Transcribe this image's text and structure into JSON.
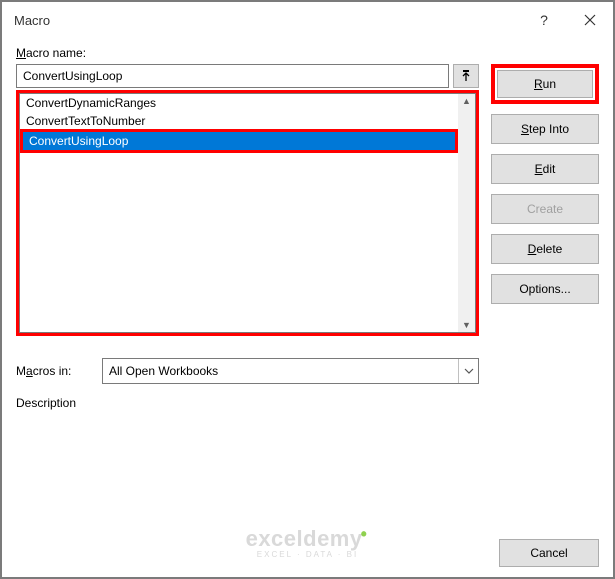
{
  "titlebar": {
    "title": "Macro"
  },
  "labels": {
    "macro_name": "Macro name:",
    "macros_in": "Macros in:",
    "description": "Description"
  },
  "name_input": {
    "value": "ConvertUsingLoop"
  },
  "list": {
    "items": [
      {
        "label": "ConvertDynamicRanges",
        "selected": false
      },
      {
        "label": "ConvertTextToNumber",
        "selected": false
      },
      {
        "label": "ConvertUsingLoop",
        "selected": true
      }
    ]
  },
  "macros_in_select": {
    "value": "All Open Workbooks"
  },
  "buttons": {
    "run": "Run",
    "step_into": "Step Into",
    "edit": "Edit",
    "create": "Create",
    "delete": "Delete",
    "options": "Options...",
    "cancel": "Cancel"
  },
  "watermark": {
    "main": "exceldemy",
    "sub": "EXCEL · DATA · BI"
  }
}
